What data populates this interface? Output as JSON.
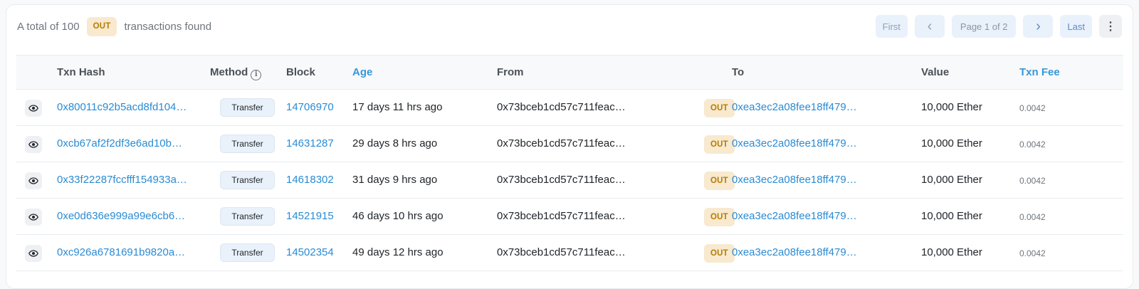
{
  "summary": {
    "prefix": "A total of 100",
    "badge": "OUT",
    "suffix": "transactions found"
  },
  "pager": {
    "first": "First",
    "prev": "‹",
    "page": "Page 1 of 2",
    "next": "›",
    "last": "Last",
    "more": "⋮"
  },
  "columns": {
    "txn_hash": "Txn Hash",
    "method": "Method",
    "block": "Block",
    "age": "Age",
    "from": "From",
    "to": "To",
    "value": "Value",
    "txn_fee": "Txn Fee"
  },
  "rows": [
    {
      "hash": "0x80011c92b5acd8fd104…",
      "method": "Transfer",
      "block": "14706970",
      "age": "17 days 11 hrs ago",
      "from": "0x73bceb1cd57c711feac…",
      "direction": "OUT",
      "to": "0xea3ec2a08fee18ff479…",
      "value": "10,000 Ether",
      "fee": "0.0042"
    },
    {
      "hash": "0xcb67af2f2df3e6ad10b…",
      "method": "Transfer",
      "block": "14631287",
      "age": "29 days 8 hrs ago",
      "from": "0x73bceb1cd57c711feac…",
      "direction": "OUT",
      "to": "0xea3ec2a08fee18ff479…",
      "value": "10,000 Ether",
      "fee": "0.0042"
    },
    {
      "hash": "0x33f22287fccfff154933a…",
      "method": "Transfer",
      "block": "14618302",
      "age": "31 days 9 hrs ago",
      "from": "0x73bceb1cd57c711feac…",
      "direction": "OUT",
      "to": "0xea3ec2a08fee18ff479…",
      "value": "10,000 Ether",
      "fee": "0.0042"
    },
    {
      "hash": "0xe0d636e999a99e6cb6…",
      "method": "Transfer",
      "block": "14521915",
      "age": "46 days 10 hrs ago",
      "from": "0x73bceb1cd57c711feac…",
      "direction": "OUT",
      "to": "0xea3ec2a08fee18ff479…",
      "value": "10,000 Ether",
      "fee": "0.0042"
    },
    {
      "hash": "0xc926a6781691b9820a…",
      "method": "Transfer",
      "block": "14502354",
      "age": "49 days 12 hrs ago",
      "from": "0x73bceb1cd57c711feac…",
      "direction": "OUT",
      "to": "0xea3ec2a08fee18ff479…",
      "value": "10,000 Ether",
      "fee": "0.0042"
    }
  ],
  "colors": {
    "link": "#2a8bd3",
    "out_badge_bg": "#f8e9cf",
    "out_badge_text": "#b47d00"
  },
  "icons": {
    "row_preview": "eye-icon",
    "method_info": "info-icon",
    "menu": "more-vertical-icon"
  }
}
